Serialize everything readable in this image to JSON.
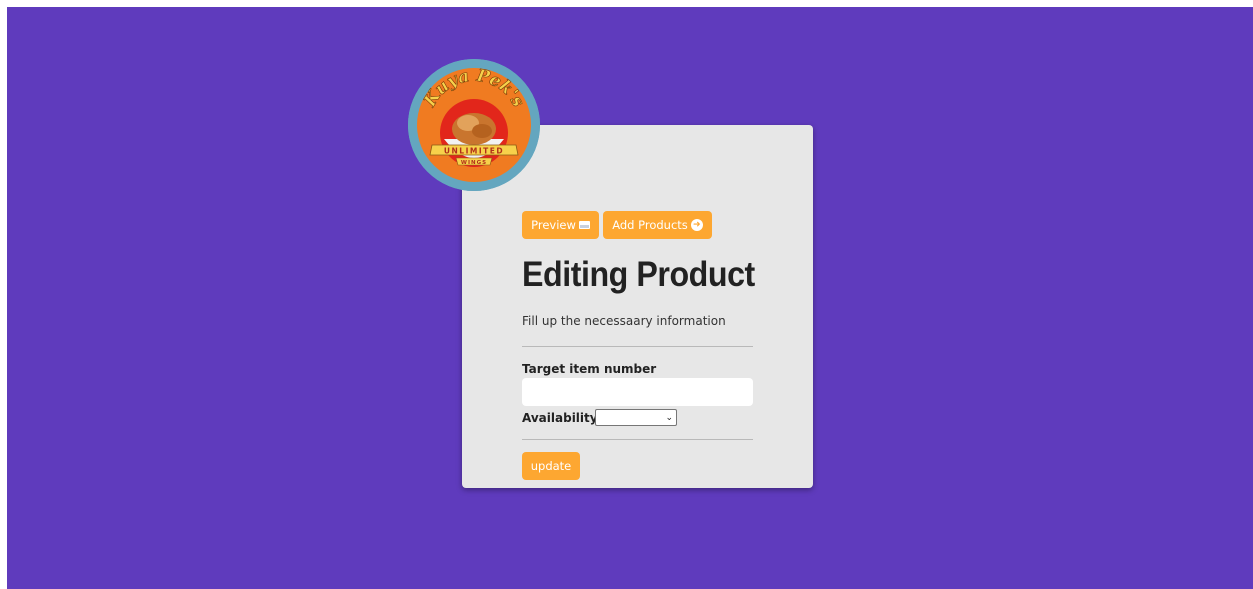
{
  "logo": {
    "text_top": "Kuya Pek's",
    "band_text": "UNLIMITED",
    "sub_text": "WINGS",
    "colors": {
      "ring": "#64a6bf",
      "disc": "#f07b21",
      "red": "#e2261b",
      "band": "#f7d14b"
    }
  },
  "toolbar": {
    "preview_label": "Preview",
    "preview_icon": "image-icon",
    "add_label": "Add Products",
    "add_icon": "arrow-circle-right-icon"
  },
  "form": {
    "title": "Editing Product",
    "subtitle": "Fill up the necessaary information",
    "target_label": "Target item number",
    "target_value": "",
    "availability_label": "Availability:",
    "availability_value": "",
    "update_label": "update"
  },
  "colors": {
    "background": "#5f3bbd",
    "card": "#e7e7e7",
    "button": "#fda731",
    "title": "#222222"
  }
}
